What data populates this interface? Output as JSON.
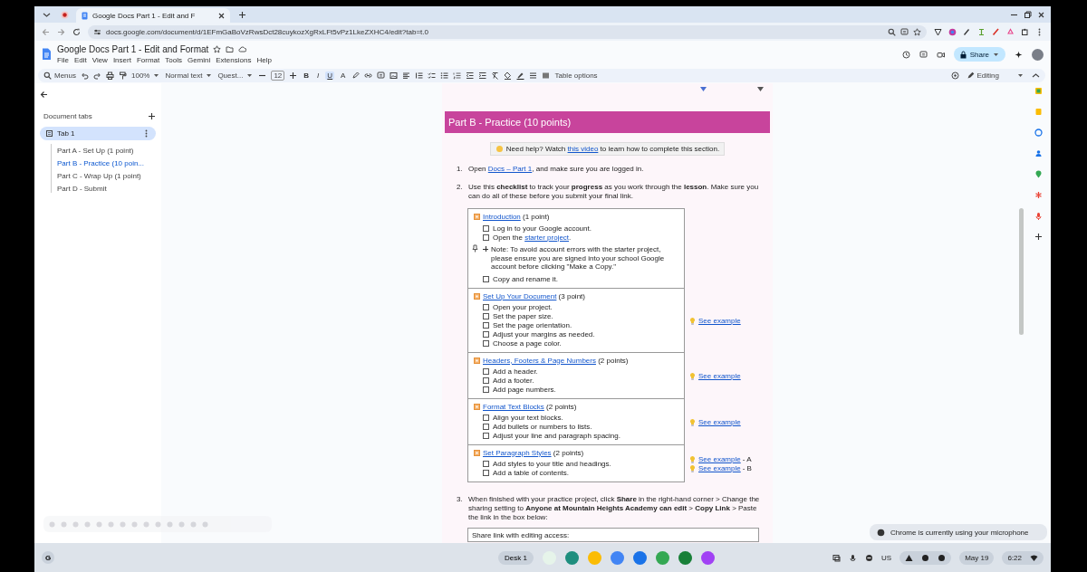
{
  "browser": {
    "tab_title": "Google Docs Part 1 - Edit and F",
    "url": "docs.google.com/document/d/1EFmGaBoVzRwsDct28cuykozXgRxLFt5vPz1LkeZXHC4/edit?tab=t.0"
  },
  "docs": {
    "title": "Google Docs Part 1 - Edit and Format",
    "menu": [
      "File",
      "Edit",
      "View",
      "Insert",
      "Format",
      "Tools",
      "Gemini",
      "Extensions",
      "Help"
    ],
    "share": "Share"
  },
  "toolbar": {
    "search": "Menus",
    "zoom": "100%",
    "style": "Normal text",
    "font": "Quest...",
    "size": "12",
    "format_buttons": [
      {
        "label": "B",
        "selected": false
      },
      {
        "label": "I",
        "selected": false
      },
      {
        "label": "U",
        "selected": true
      },
      {
        "label": "A",
        "selected": false
      }
    ],
    "table_options": "Table options",
    "mode": "Editing"
  },
  "sidebar": {
    "heading": "Document tabs",
    "tabs": [
      {
        "label": "Tab 1",
        "selected": true,
        "children": [
          {
            "label": "Part A - Set Up (1 point)",
            "selected": false
          },
          {
            "label": "Part B - Practice (10 poin...",
            "selected": true
          },
          {
            "label": "Part C - Wrap Up (1 point)",
            "selected": false
          },
          {
            "label": "Part D - Submit",
            "selected": false
          }
        ]
      }
    ]
  },
  "page": {
    "heading": "Part B - Practice (10 points)",
    "help": {
      "before": "Need help? Watch ",
      "link": "this video",
      "after": " to learn how to complete this section."
    },
    "steps": [
      {
        "number": "1.",
        "text": "Open ",
        "link": "Docs – Part 1",
        "after": ", and make sure you are logged in."
      },
      {
        "number": "2.",
        "text": "Use this **checklist** to track your **progress** as you work through the **lesson**. Make sure you can do all of these before you submit your final link."
      }
    ],
    "checklist": [
      {
        "title": "Introduction",
        "points": " (1 point)",
        "items": [
          {
            "kind": "check",
            "checked": false,
            "text": "Log in to your Google account."
          },
          {
            "kind": "check",
            "checked": false,
            "text": "Open the ",
            "link": "starter project",
            "after": "."
          },
          {
            "kind": "note",
            "text": "Note: To avoid account errors with the starter project, please ensure you are signed into your school Google account before clicking \"Make a Copy.\""
          },
          {
            "kind": "check",
            "checked": false,
            "text": "Copy and rename it."
          }
        ]
      },
      {
        "title": "Set Up Your Document",
        "points": " (3 point)",
        "items": [
          {
            "kind": "check",
            "checked": false,
            "text": "Open your project."
          },
          {
            "kind": "check",
            "checked": false,
            "text": "Set the paper size."
          },
          {
            "kind": "check",
            "checked": false,
            "text": "Set the page orientation."
          },
          {
            "kind": "check",
            "checked": false,
            "text": "Adjust your margins as needed."
          },
          {
            "kind": "check",
            "checked": false,
            "text": "Choose a page color."
          }
        ],
        "examples": [
          {
            "label": "See example"
          }
        ]
      },
      {
        "title": "Headers, Footers & Page Numbers",
        "points": " (2 points)",
        "items": [
          {
            "kind": "check",
            "checked": false,
            "text": "Add a header."
          },
          {
            "kind": "check",
            "checked": false,
            "text": "Add a footer."
          },
          {
            "kind": "check",
            "checked": false,
            "text": "Add page numbers."
          }
        ],
        "examples": [
          {
            "label": "See example"
          }
        ]
      },
      {
        "title": "Format Text Blocks",
        "points": " (2 points)",
        "items": [
          {
            "kind": "check",
            "checked": false,
            "text": "Align your text blocks."
          },
          {
            "kind": "check",
            "checked": false,
            "text": "Add bullets or numbers to lists."
          },
          {
            "kind": "check",
            "checked": false,
            "text": "Adjust your line and paragraph spacing."
          }
        ],
        "examples": [
          {
            "label": "See example"
          }
        ]
      },
      {
        "title": "Set Paragraph Styles",
        "points": " (2 points)",
        "items": [
          {
            "kind": "check",
            "checked": false,
            "text": "Add styles to your title and headings."
          },
          {
            "kind": "check",
            "checked": false,
            "text": "Add a table of contents."
          }
        ],
        "examples": [
          {
            "label": "See example",
            "suffix": " - A"
          },
          {
            "label": "See example",
            "suffix": " - B"
          }
        ]
      }
    ],
    "final_step": {
      "number": "3.",
      "text": "When finished with your practice project, click **Share** in the right-hand corner > Change the sharing setting to **Anyone at Mountain Heights Academy can edit** > **Copy Link** > Paste the link in the box below:"
    },
    "share_box": {
      "label": "Share link with editing access:"
    }
  },
  "toast": "Chrome is currently using your microphone",
  "shelf": {
    "launcher": "G",
    "desk": "Desk 1",
    "input_method": "US",
    "date": "May 19",
    "time": "6:22"
  }
}
